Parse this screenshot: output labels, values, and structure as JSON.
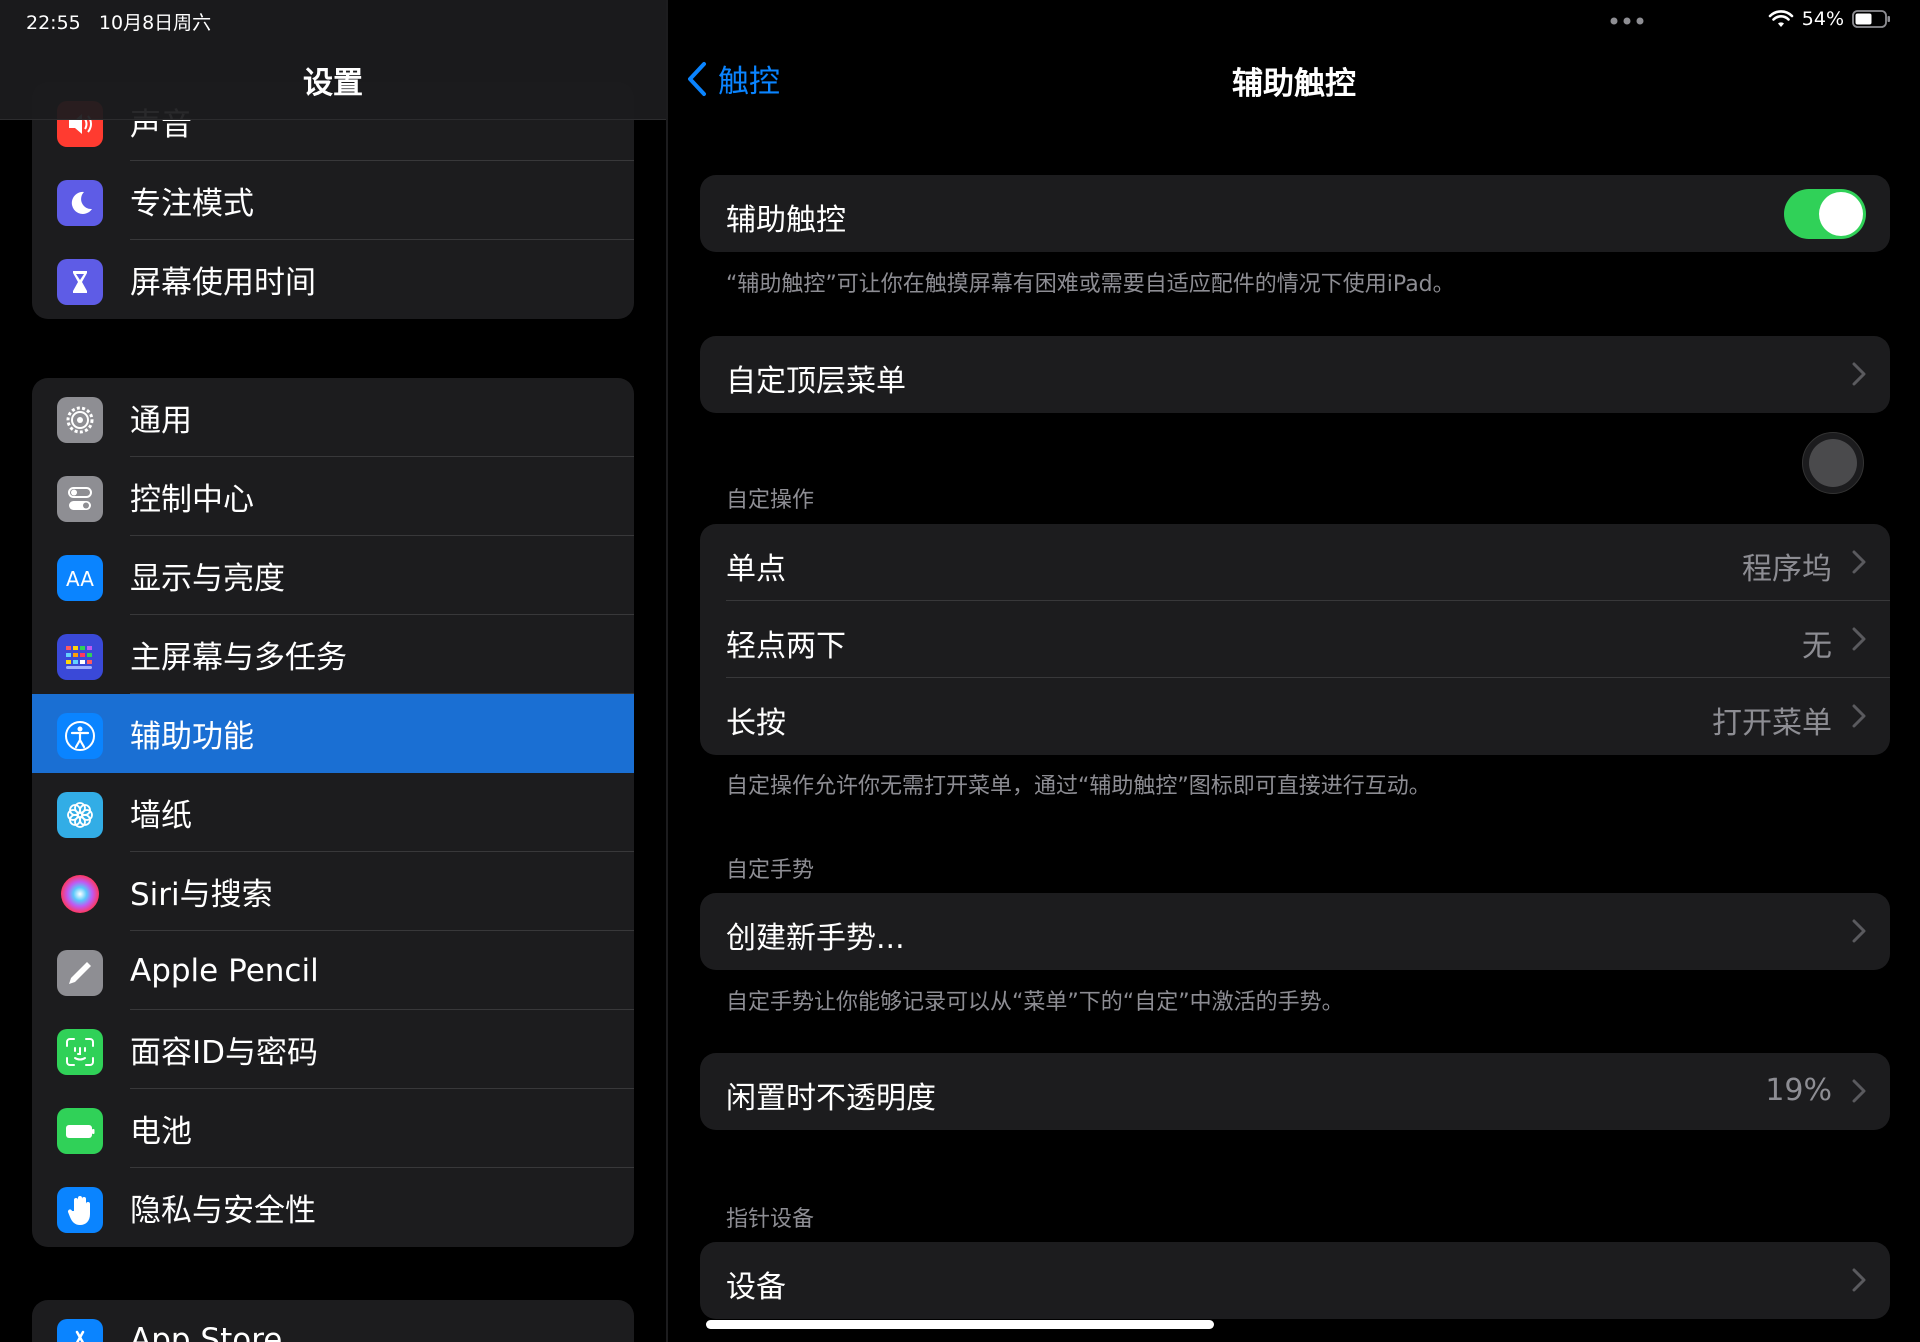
{
  "status_bar": {
    "time": "22:55",
    "date": "10月8日周六",
    "battery": "54%"
  },
  "sidebar": {
    "title": "设置",
    "group1": [
      {
        "label": "声音",
        "icon": "speaker-icon",
        "color": "#ff3b30"
      },
      {
        "label": "专注模式",
        "icon": "moon-icon",
        "color": "#5e5ce6"
      },
      {
        "label": "屏幕使用时间",
        "icon": "hourglass-icon",
        "color": "#5e5ce6"
      }
    ],
    "group2": [
      {
        "label": "通用",
        "icon": "gear-icon",
        "color": "#8e8e93"
      },
      {
        "label": "控制中心",
        "icon": "toggles-icon",
        "color": "#8e8e93"
      },
      {
        "label": "显示与亮度",
        "icon": "text-size-icon",
        "color": "#0a84ff"
      },
      {
        "label": "主屏幕与多任务",
        "icon": "app-grid-icon",
        "color": "#3a49d8"
      },
      {
        "label": "辅助功能",
        "icon": "accessibility-icon",
        "color": "#0a84ff",
        "selected": true
      },
      {
        "label": "墙纸",
        "icon": "flower-icon",
        "color": "#32ade6"
      },
      {
        "label": "Siri与搜索",
        "icon": "siri-icon",
        "color": "#1c1c1e"
      },
      {
        "label": "Apple Pencil",
        "icon": "pencil-icon",
        "color": "#8e8e93"
      },
      {
        "label": "面容ID与密码",
        "icon": "face-id-icon",
        "color": "#30d158"
      },
      {
        "label": "电池",
        "icon": "battery-icon",
        "color": "#30d158"
      },
      {
        "label": "隐私与安全性",
        "icon": "hand-icon",
        "color": "#0a84ff"
      }
    ],
    "group3": [
      {
        "label": "App Store",
        "icon": "app-store-icon",
        "color": "#0a84ff"
      }
    ]
  },
  "detail": {
    "back_label": "触控",
    "title": "辅助触控",
    "toggle_row": {
      "label": "辅助触控",
      "on": true
    },
    "toggle_footer": "“辅助触控”可让你在触摸屏幕有困难或需要自适应配件的情况下使用iPad。",
    "top_menu": {
      "label": "自定顶层菜单"
    },
    "custom_actions": {
      "header": "自定操作",
      "rows": [
        {
          "label": "单点",
          "value": "程序坞"
        },
        {
          "label": "轻点两下",
          "value": "无"
        },
        {
          "label": "长按",
          "value": "打开菜单"
        }
      ],
      "footer": "自定操作允许你无需打开菜单，通过“辅助触控”图标即可直接进行互动。"
    },
    "custom_gestures": {
      "header": "自定手势",
      "row": {
        "label": "创建新手势..."
      },
      "footer": "自定手势让你能够记录可以从“菜单”下的“自定”中激活的手势。"
    },
    "idle_opacity": {
      "label": "闲置时不透明度",
      "value": "19%"
    },
    "pointer_devices": {
      "header": "指针设备",
      "row": {
        "label": "设备"
      }
    }
  }
}
